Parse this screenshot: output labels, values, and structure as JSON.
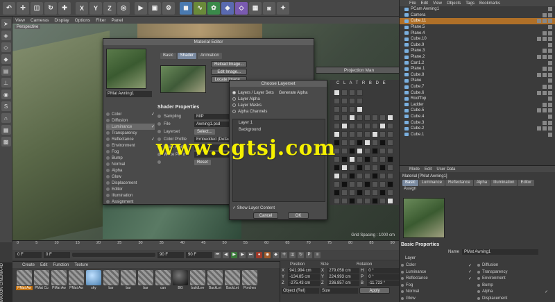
{
  "toolbar": {
    "icons": [
      "undo-icon",
      "move-icon",
      "scale-icon",
      "rotate-icon",
      "select-icon",
      "x-axis",
      "y-axis",
      "z-axis",
      "world-icon",
      "render-icon",
      "render-view-icon",
      "render-settings-icon",
      "cube-icon",
      "spline-icon",
      "nurbs-icon",
      "array-icon",
      "deformer-icon",
      "scene-icon",
      "camera-icon",
      "light-icon"
    ],
    "axes": [
      "X",
      "Y",
      "Z"
    ]
  },
  "viewport": {
    "menu": [
      "View",
      "Cameras",
      "Display",
      "Options",
      "Filter",
      "Panel"
    ],
    "label": "Perspective",
    "grid_spacing": "Grid Spacing : 1000 cm"
  },
  "watermark": "www.cgtsj.com",
  "material_editor": {
    "title": "Material Editor",
    "material_name": "PMat Awning1",
    "channels": [
      {
        "label": "Color",
        "checked": "✓"
      },
      {
        "label": "Diffusion",
        "checked": ""
      },
      {
        "label": "Luminance",
        "checked": "✓"
      },
      {
        "label": "Transparency",
        "checked": ""
      },
      {
        "label": "Reflectance",
        "checked": "✓"
      },
      {
        "label": "Environment",
        "checked": ""
      },
      {
        "label": "Fog",
        "checked": ""
      },
      {
        "label": "Bump",
        "checked": ""
      },
      {
        "label": "Normal",
        "checked": ""
      },
      {
        "label": "Alpha",
        "checked": ""
      },
      {
        "label": "Glow",
        "checked": ""
      },
      {
        "label": "Displacement",
        "checked": ""
      },
      {
        "label": "Editor",
        "checked": ""
      },
      {
        "label": "Illumination",
        "checked": ""
      },
      {
        "label": "Assignment",
        "checked": ""
      }
    ],
    "tabs": [
      "Basic",
      "Shader",
      "Animation"
    ],
    "buttons": [
      "Reload Image...",
      "Edit Image...",
      "Locate Image..."
    ],
    "section": "Shader Properties",
    "fields": [
      {
        "label": "Sampling",
        "value": "MIP"
      },
      {
        "label": "File",
        "value": "Awning1.psd"
      },
      {
        "label": "Layerset",
        "value": "Select..."
      },
      {
        "label": "Color Profile",
        "value": "Embedded (Default)"
      },
      {
        "label": "Black Point",
        "value": "0"
      },
      {
        "label": "White Point",
        "value": "1"
      },
      {
        "label": "",
        "value": "Reset"
      }
    ]
  },
  "projection_man": {
    "title": "Projection Man",
    "columns": "C L A T R B D E"
  },
  "layerset": {
    "title": "Choose Layerset",
    "options": [
      "Layers / Layer Sets",
      "Layer Alpha",
      "Layer Masks",
      "Alpha Channels"
    ],
    "generate_alpha": "Generate Alpha",
    "layers": [
      "Layer 1",
      "Background"
    ],
    "show_content": "Show Layer Content",
    "cancel": "Cancel",
    "ok": "OK"
  },
  "objects": {
    "menu": [
      "File",
      "Edit",
      "View",
      "Objects",
      "Tags",
      "Bookmarks"
    ],
    "items": [
      "PCam Awning1",
      "Camera",
      "Cube.11",
      "Plane.5",
      "Plane.4",
      "Cube.10",
      "Cube.9",
      "Plane.3",
      "Plane.2",
      "Can1.2",
      "Plane.1",
      "Cube.8",
      "Plane",
      "Cube.7",
      "Cube.6",
      "RoofTop",
      "Ladder",
      "Cube.5",
      "Cube.4",
      "Cube.3",
      "Cube.2",
      "Cube.1"
    ],
    "selected": 2
  },
  "attributes": {
    "menu": [
      "Mode",
      "Edit",
      "User Data"
    ],
    "title": "Material [PMat Awning1]",
    "tabs": [
      "Basic",
      "Luminance",
      "Reflectance",
      "Alpha",
      "Illumination",
      "Editor"
    ],
    "assign": "Assign",
    "section": "Basic Properties",
    "name_label": "Name",
    "name_value": "PMat Awning1",
    "layer_label": "Layer",
    "grid": [
      {
        "l": "Color",
        "c": "✓"
      },
      {
        "l": "Diffusion",
        "c": ""
      },
      {
        "l": "Luminance",
        "c": "✓"
      },
      {
        "l": "Transparency",
        "c": ""
      },
      {
        "l": "Reflectance",
        "c": "✓"
      },
      {
        "l": "Environment",
        "c": ""
      },
      {
        "l": "Fog",
        "c": ""
      },
      {
        "l": "Bump",
        "c": ""
      },
      {
        "l": "Normal",
        "c": ""
      },
      {
        "l": "Alpha",
        "c": "✓"
      },
      {
        "l": "Glow",
        "c": ""
      },
      {
        "l": "Displacement",
        "c": ""
      }
    ]
  },
  "timeline": {
    "ticks": [
      "0",
      "5",
      "10",
      "15",
      "20",
      "25",
      "30",
      "35",
      "40",
      "45",
      "50",
      "55",
      "60",
      "65",
      "70",
      "75",
      "80",
      "85",
      "90"
    ],
    "start": "0 F",
    "current": "0 F",
    "end": "90 F",
    "end2": "90 F"
  },
  "materials": {
    "menu": [
      "Create",
      "Edit",
      "Function",
      "Texture"
    ],
    "items": [
      "PMat Aw",
      "PMat Cu",
      "PMat Aw",
      "PMat Aw",
      "sky",
      "bar",
      "bar",
      "bar",
      "can",
      "BG",
      "buildLee",
      "BackLet",
      "BackLet",
      "Porches"
    ]
  },
  "logo": "MAXON CINEMA 4D",
  "coords": {
    "headers": [
      "Position",
      "Size",
      "Rotation"
    ],
    "rows": [
      {
        "ax": "X",
        "p": "941.994 cm",
        "ax2": "X",
        "s": "279.058 cm",
        "ax3": "H",
        "r": "0 °"
      },
      {
        "ax": "Y",
        "p": "-134.85 cm",
        "ax2": "Y",
        "s": "224.993 cm",
        "ax3": "P",
        "r": "0 °"
      },
      {
        "ax": "Z",
        "p": "-275.43 cm",
        "ax2": "Z",
        "s": "236.857 cm",
        "ax3": "B",
        "r": "-11.723 °"
      }
    ],
    "mode": "Object (Rel)",
    "size_mode": "Size",
    "apply": "Apply"
  },
  "colors": {
    "accent": "#c07010",
    "tab_active": "#7a8aa0",
    "watermark": "#f5f000"
  }
}
